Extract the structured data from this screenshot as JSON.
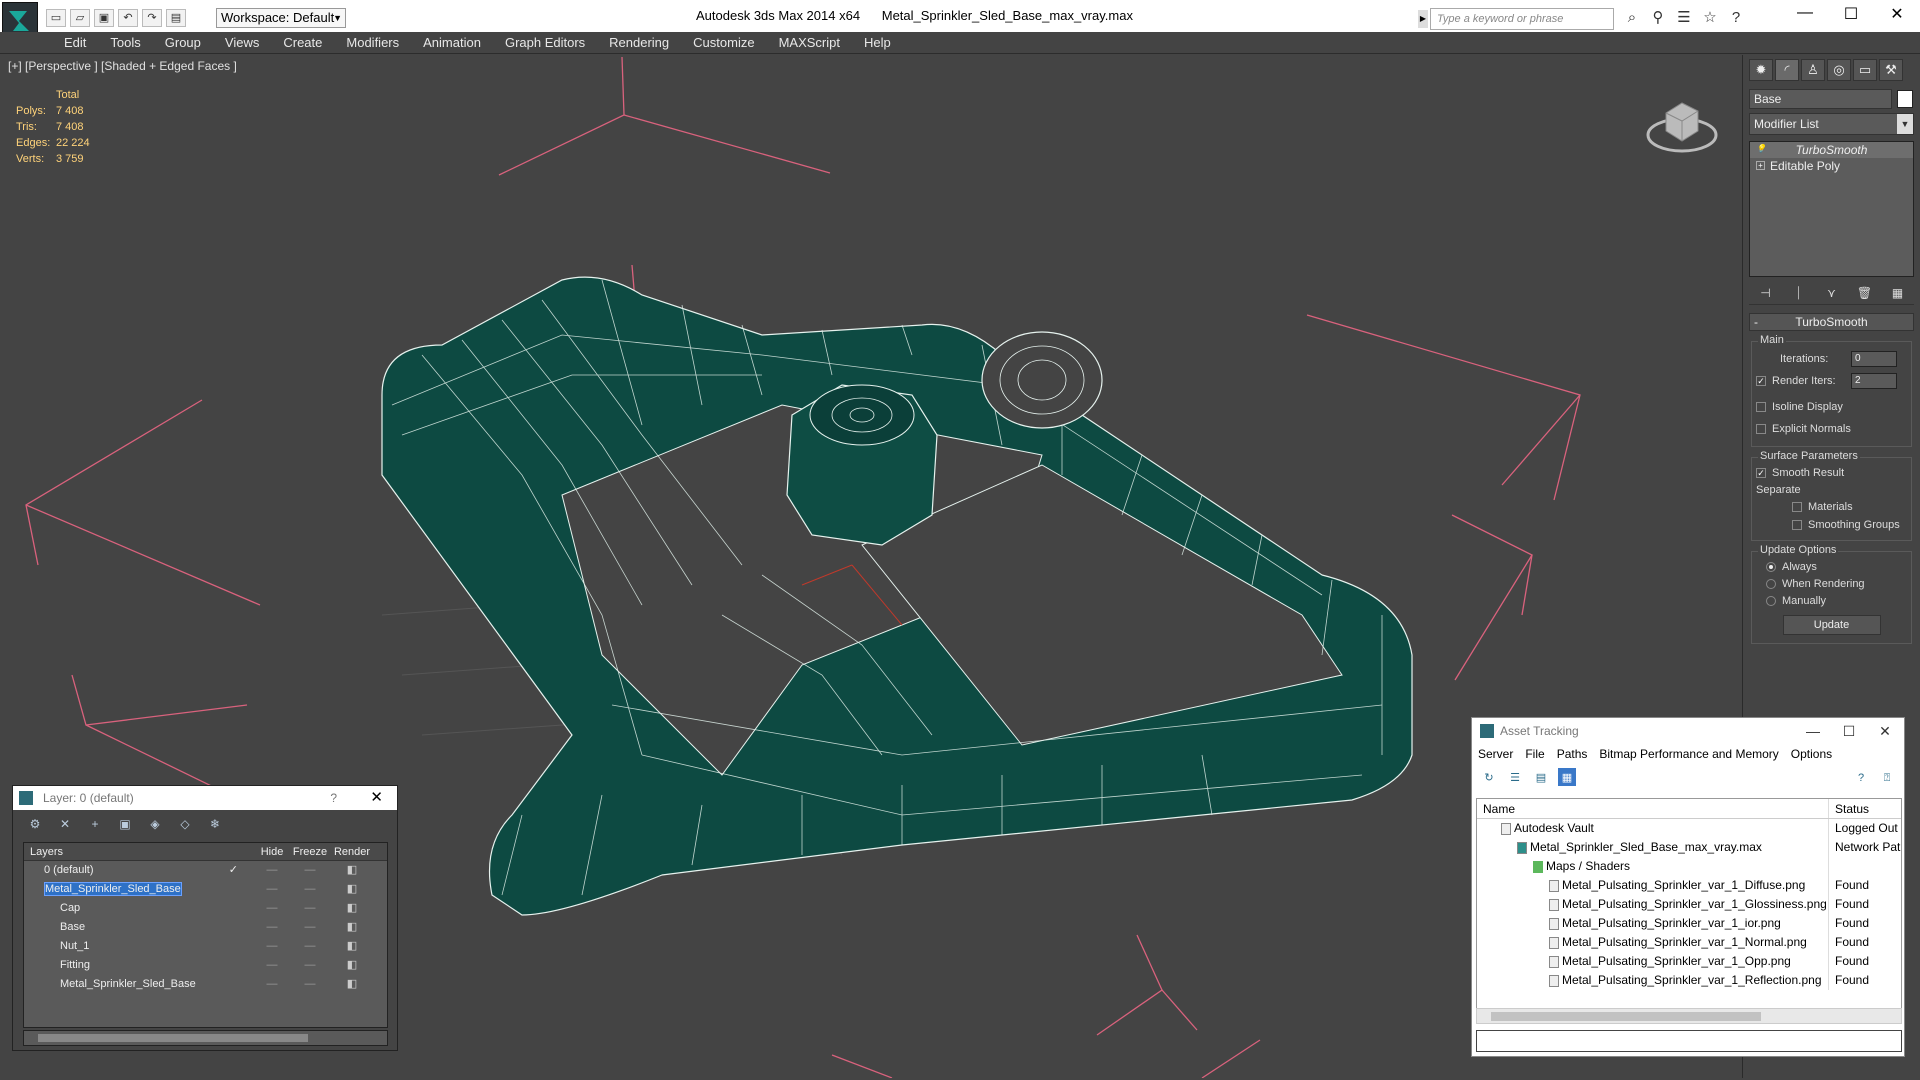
{
  "titlebar": {
    "workspace_label": "Workspace: Default",
    "app_title": "Autodesk 3ds Max  2014 x64",
    "file_title": "Metal_Sprinkler_Sled_Base_max_vray.max",
    "search_placeholder": "Type a keyword or phrase"
  },
  "menu": [
    "Edit",
    "Tools",
    "Group",
    "Views",
    "Create",
    "Modifiers",
    "Animation",
    "Graph Editors",
    "Rendering",
    "Customize",
    "MAXScript",
    "Help"
  ],
  "viewport": {
    "label": "[+] [Perspective ] [Shaded + Edged Faces ]",
    "stats_header": "Total",
    "stats": [
      {
        "k": "Polys:",
        "v": "7 408"
      },
      {
        "k": "Tris:",
        "v": "7 408"
      },
      {
        "k": "Edges:",
        "v": "22 224"
      },
      {
        "k": "Verts:",
        "v": "3 759"
      }
    ],
    "mesh_color": "#0d4a42"
  },
  "cmdpanel": {
    "object_name": "Base",
    "modifier_list": "Modifier List",
    "stack": [
      "TurboSmooth",
      "Editable Poly"
    ],
    "rollout_title": "TurboSmooth",
    "main_group": "Main",
    "iterations_label": "Iterations:",
    "iterations_value": "0",
    "render_iters_label": "Render Iters:",
    "render_iters_value": "2",
    "isoline": "Isoline Display",
    "explicit": "Explicit Normals",
    "surface_group": "Surface Parameters",
    "smooth_result": "Smooth Result",
    "separate": "Separate",
    "materials": "Materials",
    "smoothing_groups": "Smoothing Groups",
    "update_group": "Update Options",
    "always": "Always",
    "when_rendering": "When Rendering",
    "manually": "Manually",
    "update_btn": "Update"
  },
  "layer_window": {
    "title": "Layer: 0 (default)",
    "help": "?",
    "headers": {
      "layers": "Layers",
      "hide": "Hide",
      "freeze": "Freeze",
      "render": "Render"
    },
    "rows": [
      {
        "name": "0 (default)",
        "indent": 0,
        "check": "✓"
      },
      {
        "name": "Metal_Sprinkler_Sled_Base",
        "indent": 0,
        "check": ""
      },
      {
        "name": "Cap",
        "indent": 1,
        "check": ""
      },
      {
        "name": "Base",
        "indent": 1,
        "check": ""
      },
      {
        "name": "Nut_1",
        "indent": 1,
        "check": ""
      },
      {
        "name": "Fitting",
        "indent": 1,
        "check": ""
      },
      {
        "name": "Metal_Sprinkler_Sled_Base",
        "indent": 1,
        "check": ""
      }
    ]
  },
  "asset_window": {
    "title": "Asset Tracking",
    "menu": [
      "Server",
      "File",
      "Paths",
      "Bitmap Performance and Memory",
      "Options"
    ],
    "headers": {
      "name": "Name",
      "status": "Status"
    },
    "rows": [
      {
        "name": "Autodesk Vault",
        "indent": 1,
        "status": "Logged Out"
      },
      {
        "name": "Metal_Sprinkler_Sled_Base_max_vray.max",
        "indent": 2,
        "status": "Network Pat"
      },
      {
        "name": "Maps / Shaders",
        "indent": 3,
        "status": ""
      },
      {
        "name": "Metal_Pulsating_Sprinkler_var_1_Diffuse.png",
        "indent": 4,
        "status": "Found"
      },
      {
        "name": "Metal_Pulsating_Sprinkler_var_1_Glossiness.png",
        "indent": 4,
        "status": "Found"
      },
      {
        "name": "Metal_Pulsating_Sprinkler_var_1_ior.png",
        "indent": 4,
        "status": "Found"
      },
      {
        "name": "Metal_Pulsating_Sprinkler_var_1_Normal.png",
        "indent": 4,
        "status": "Found"
      },
      {
        "name": "Metal_Pulsating_Sprinkler_var_1_Opp.png",
        "indent": 4,
        "status": "Found"
      },
      {
        "name": "Metal_Pulsating_Sprinkler_var_1_Reflection.png",
        "indent": 4,
        "status": "Found"
      }
    ]
  }
}
